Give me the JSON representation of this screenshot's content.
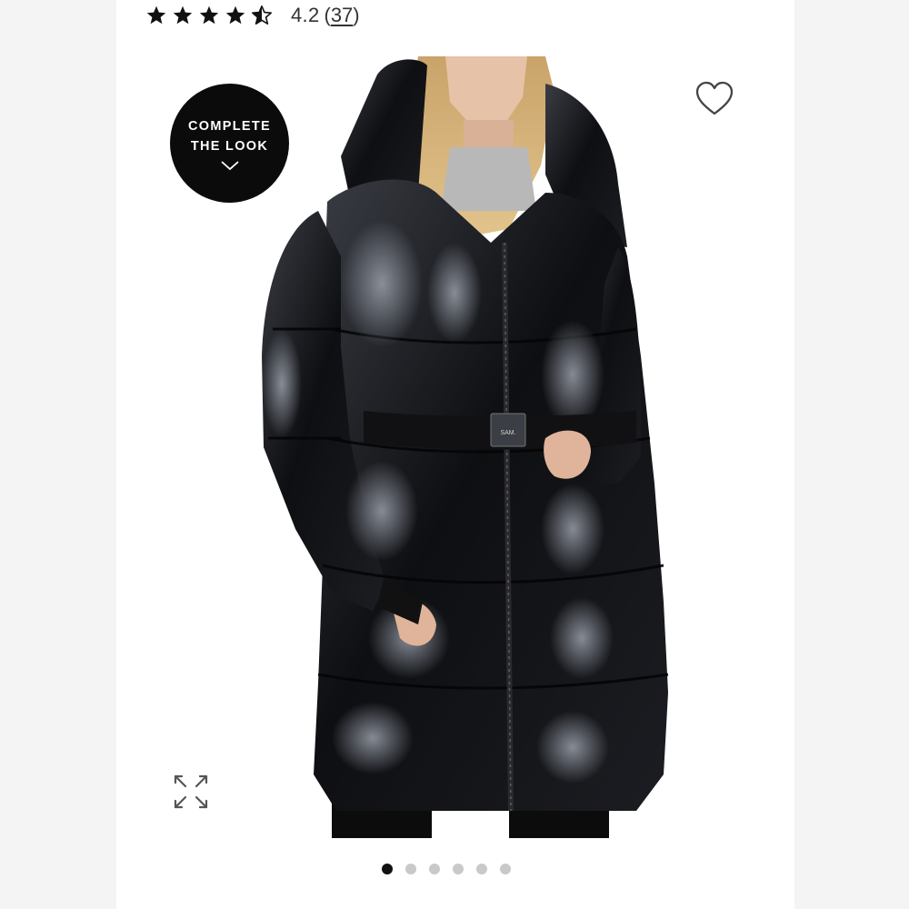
{
  "rating": {
    "value": "4.2",
    "count_open": "(",
    "count": "37",
    "count_close": ")",
    "stars": [
      "full",
      "full",
      "full",
      "full",
      "half"
    ],
    "star_color": "#111111"
  },
  "badge": {
    "line1": "COMPLETE",
    "line2": "THE LOOK",
    "icon": "chevron-down-icon"
  },
  "product": {
    "image_subject": "puffer-coat-photo",
    "belt_buckle_text": "SAM."
  },
  "actions": {
    "favorite_icon": "heart-outline-icon",
    "expand_icon": "expand-arrows-icon"
  },
  "carousel": {
    "total": 6,
    "active_index": 0
  },
  "colors": {
    "accent": "#0b0b0b",
    "dot_inactive": "#c9c9c9"
  }
}
